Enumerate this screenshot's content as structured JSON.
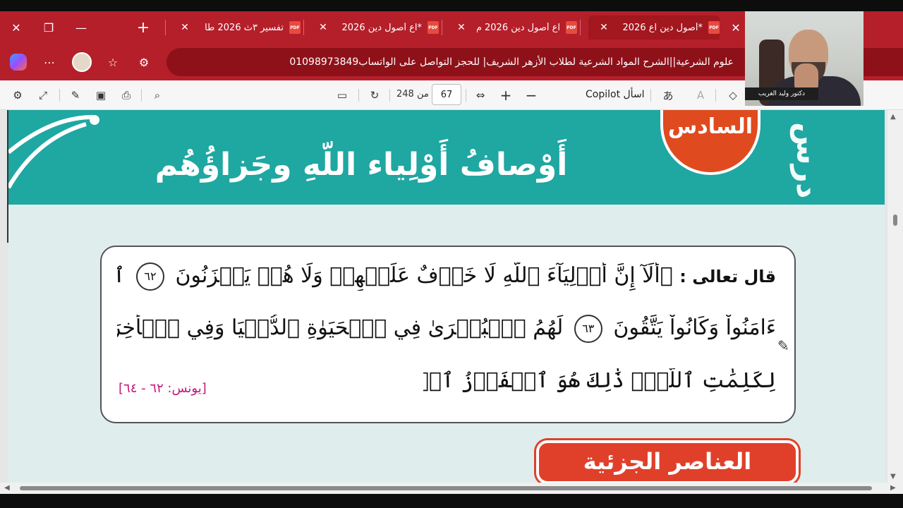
{
  "tabs": [
    {
      "title": "*أصول دين اع 2026",
      "active": true
    },
    {
      "title": "اع أصول دين 2026 م",
      "active": false
    },
    {
      "title": "*اع أصول دين 2026",
      "active": false
    },
    {
      "title": "تفسير ٣ث 2026 طا",
      "active": false
    }
  ],
  "tab_icon_text": "PDF",
  "address": {
    "text": "علوم الشرعية||الشرح المواد الشرعية لطلاب الأزهر الشريف| للحجز التواصل على الواتساب01098973849"
  },
  "toolbar": {
    "ask_copilot": "اسأل Copilot",
    "page_current": "67",
    "page_of": "من 248"
  },
  "document": {
    "badge": "السادس",
    "side_word": "درس",
    "lesson_title": "أَوْصافُ أَوْلِياء اللّهِ وجَزاؤُهُم",
    "verse_label": "قال تعالى :",
    "verse_line1": "﴿أَلَآ إِنَّ أَوۡلِيَآءَ ٱللَّهِ لَا خَوۡفٌ عَلَيۡهِمۡ وَلَا هُمۡ يَحۡزَنُونَ",
    "ayah_62": "٦٢",
    "verse_line1_end": "ٱلَّذِينَ",
    "verse_line2": "ءَامَنُواْ وَكَانُواْ يَتَّقُونَ",
    "ayah_63": "٦٣",
    "verse_line2_end": "لَهُمُ ٱلۡبُشۡرَىٰ فِي ٱلۡحَيَوٰةِ ٱلدُّنۡيَا وَفِي ٱلۡأٓخِرَةِۚ لَا تَبۡدِيلَ",
    "verse_line3": "لِكَلِمَٰتِ ٱللَّهِۚ ذَٰلِكَ هُوَ ٱلۡفَوۡزُ ٱلۡعَظِيمُ ﴾.",
    "citation": "[يونس: ٦٢ - ٦٤]",
    "elements_heading": "العناصر الجزئية للدرس:"
  },
  "webcam": {
    "label": "دكتور وليد الغريب"
  },
  "colors": {
    "browser_red": "#b51f2a",
    "banner_teal": "#1fa7a2",
    "badge_orange": "#e04a1f",
    "citation_magenta": "#c2187a"
  }
}
